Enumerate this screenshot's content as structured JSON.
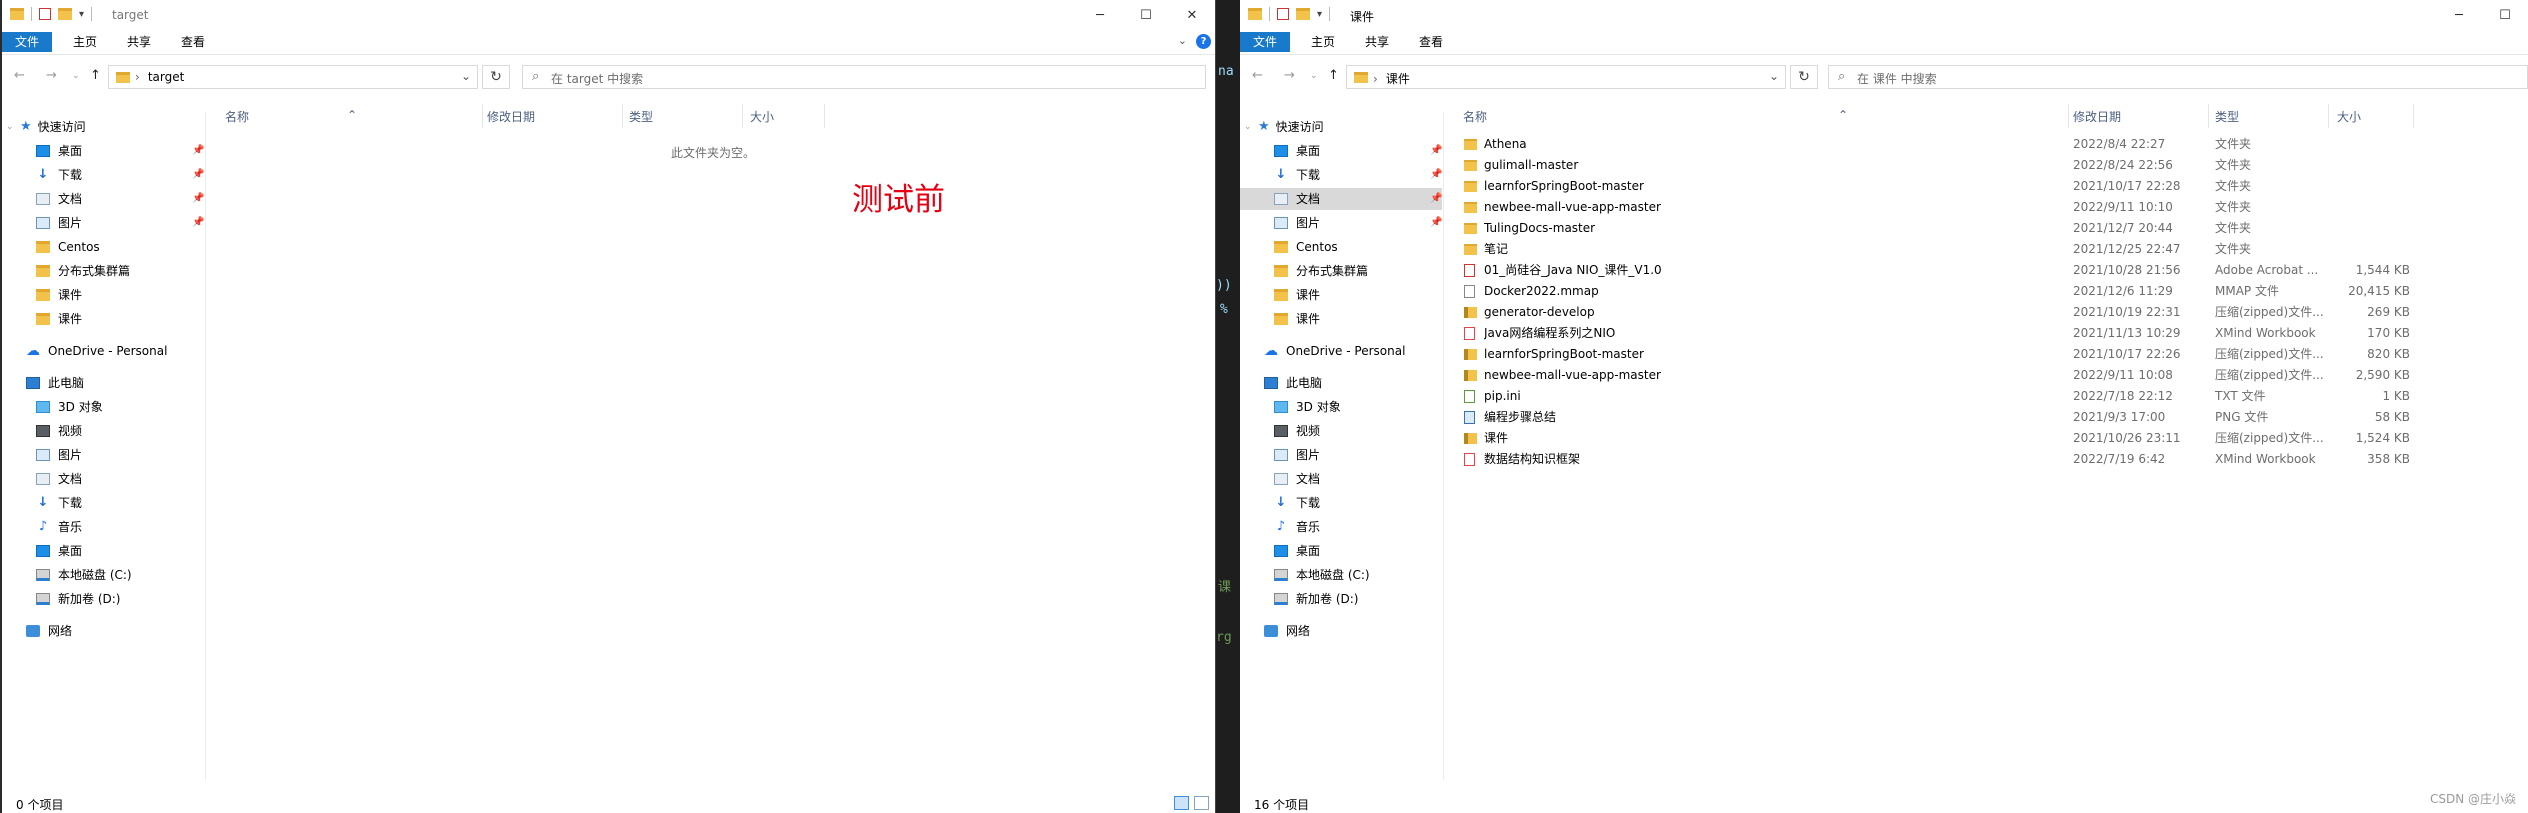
{
  "left": {
    "title": "target",
    "ribbon_tabs": [
      "文件",
      "主页",
      "共享",
      "查看"
    ],
    "address": "target",
    "search_placeholder": "在 target 中搜索",
    "columns": [
      "名称",
      "修改日期",
      "类型",
      "大小"
    ],
    "empty_text": "此文件夹为空。",
    "annotation": "测试前",
    "status": "0 个项目"
  },
  "right": {
    "title": "课件",
    "ribbon_tabs": [
      "文件",
      "主页",
      "共享",
      "查看"
    ],
    "address": "课件",
    "search_placeholder": "在 课件 中搜索",
    "columns": [
      "名称",
      "修改日期",
      "类型",
      "大小"
    ],
    "status": "16 个项目",
    "files": [
      {
        "name": "Athena",
        "date": "2022/8/4 22:27",
        "type": "文件夹",
        "size": "",
        "icon": "folder"
      },
      {
        "name": "gulimall-master",
        "date": "2022/8/24 22:56",
        "type": "文件夹",
        "size": "",
        "icon": "folder"
      },
      {
        "name": "learnforSpringBoot-master",
        "date": "2021/10/17 22:28",
        "type": "文件夹",
        "size": "",
        "icon": "folder"
      },
      {
        "name": "newbee-mall-vue-app-master",
        "date": "2022/9/11 10:10",
        "type": "文件夹",
        "size": "",
        "icon": "folder"
      },
      {
        "name": "TulingDocs-master",
        "date": "2021/12/7 20:44",
        "type": "文件夹",
        "size": "",
        "icon": "folder"
      },
      {
        "name": "笔记",
        "date": "2021/12/25 22:47",
        "type": "文件夹",
        "size": "",
        "icon": "folder"
      },
      {
        "name": "01_尚硅谷_Java NIO_课件_V1.0",
        "date": "2021/10/28 21:56",
        "type": "Adobe Acrobat ...",
        "size": "1,544 KB",
        "icon": "pdf"
      },
      {
        "name": "Docker2022.mmap",
        "date": "2021/12/6 11:29",
        "type": "MMAP 文件",
        "size": "20,415 KB",
        "icon": "mmap"
      },
      {
        "name": "generator-develop",
        "date": "2021/10/19 22:31",
        "type": "压缩(zipped)文件...",
        "size": "269 KB",
        "icon": "zip"
      },
      {
        "name": "Java网络编程系列之NIO",
        "date": "2021/11/13 10:29",
        "type": "XMind Workbook",
        "size": "170 KB",
        "icon": "xmind"
      },
      {
        "name": "learnforSpringBoot-master",
        "date": "2021/10/17 22:26",
        "type": "压缩(zipped)文件...",
        "size": "820 KB",
        "icon": "zip"
      },
      {
        "name": "newbee-mall-vue-app-master",
        "date": "2022/9/11 10:08",
        "type": "压缩(zipped)文件...",
        "size": "2,590 KB",
        "icon": "zip"
      },
      {
        "name": "pip.ini",
        "date": "2022/7/18 22:12",
        "type": "TXT 文件",
        "size": "1 KB",
        "icon": "txt"
      },
      {
        "name": "编程步骤总结",
        "date": "2021/9/3 17:00",
        "type": "PNG 文件",
        "size": "58 KB",
        "icon": "png"
      },
      {
        "name": "课件",
        "date": "2021/10/26 23:11",
        "type": "压缩(zipped)文件...",
        "size": "1,524 KB",
        "icon": "zip"
      },
      {
        "name": "数据结构知识框架",
        "date": "2022/7/19 6:42",
        "type": "XMind Workbook",
        "size": "358 KB",
        "icon": "xmind"
      }
    ]
  },
  "nav": {
    "quick_access": "快速访问",
    "pinned": [
      {
        "label": "桌面",
        "icon": "desktop-icon",
        "pinned": true
      },
      {
        "label": "下载",
        "icon": "download-icon",
        "pinned": true
      },
      {
        "label": "文档",
        "icon": "documents-icon",
        "pinned": true
      },
      {
        "label": "图片",
        "icon": "pictures-icon",
        "pinned": true
      },
      {
        "label": "Centos",
        "icon": "folder-icon",
        "pinned": false
      },
      {
        "label": "分布式集群篇",
        "icon": "folder-icon",
        "pinned": false
      },
      {
        "label": "课件",
        "icon": "folder-icon",
        "pinned": false
      },
      {
        "label": "课件",
        "icon": "folder-icon",
        "pinned": false
      }
    ],
    "onedrive": "OneDrive - Personal",
    "this_pc": "此电脑",
    "pc_items": [
      {
        "label": "3D 对象",
        "icon": "3d-objects-icon"
      },
      {
        "label": "视频",
        "icon": "videos-icon"
      },
      {
        "label": "图片",
        "icon": "pictures-icon"
      },
      {
        "label": "文档",
        "icon": "documents-icon"
      },
      {
        "label": "下载",
        "icon": "download-icon"
      },
      {
        "label": "音乐",
        "icon": "music-icon"
      },
      {
        "label": "桌面",
        "icon": "desktop-icon"
      },
      {
        "label": "本地磁盘 (C:)",
        "icon": "drive-icon"
      },
      {
        "label": "新加卷 (D:)",
        "icon": "drive-icon"
      }
    ],
    "network": "网络"
  },
  "background_code": [
    "na",
    "))",
    "%",
    "课",
    "rg"
  ],
  "watermark": "CSDN @庄小焱",
  "colors": {
    "accent": "#1979ca",
    "annotation": "#e60012",
    "selected": "#d9d9d9"
  }
}
